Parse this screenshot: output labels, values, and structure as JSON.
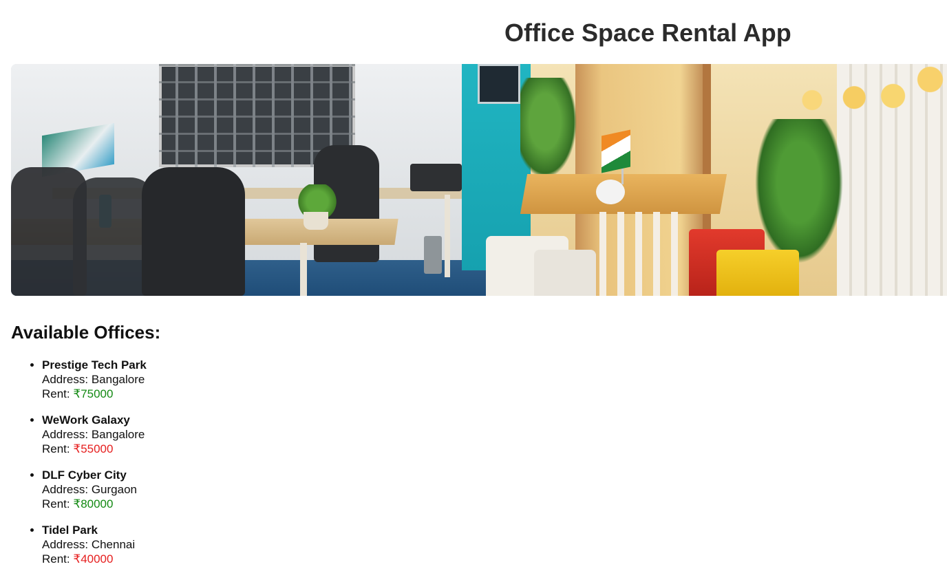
{
  "header": {
    "title": "Office Space Rental App"
  },
  "banner": {
    "icon": "office-photo",
    "description_alt": "Office workspace"
  },
  "section": {
    "heading": "Available Offices:"
  },
  "labels": {
    "address": "Address:",
    "rent": "Rent:"
  },
  "offices": [
    {
      "name": "Prestige Tech Park",
      "address": "Bangalore",
      "rent": "₹75000",
      "rent_color": "#148a14"
    },
    {
      "name": "WeWork Galaxy",
      "address": "Bangalore",
      "rent": "₹55000",
      "rent_color": "#e61f1f"
    },
    {
      "name": "DLF Cyber City",
      "address": "Gurgaon",
      "rent": "₹80000",
      "rent_color": "#148a14"
    },
    {
      "name": "Tidel Park",
      "address": "Chennai",
      "rent": "₹40000",
      "rent_color": "#e61f1f"
    }
  ],
  "colors": {
    "rent_above_threshold": "#148a14",
    "rent_below_threshold": "#e61f1f",
    "title": "#2b2b2b"
  }
}
